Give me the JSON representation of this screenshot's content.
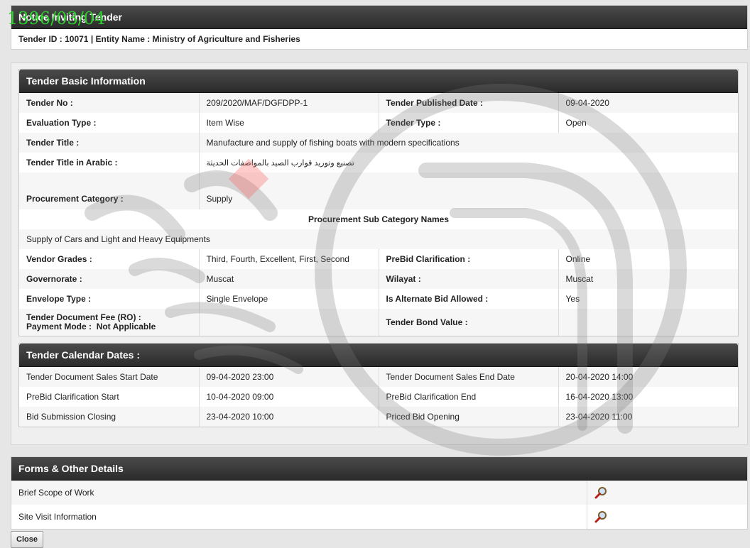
{
  "stamp": "1396/03/04",
  "notice": {
    "title": "Notice Inviting Tender",
    "id_line": "Tender ID : 10071 | Entity Name : Ministry of Agriculture and Fisheries"
  },
  "basic": {
    "title": "Tender Basic Information",
    "tender_no_label": "Tender No :",
    "tender_no": "209/2020/MAF/DGFDPP-1",
    "published_label": "Tender Published Date :",
    "published": "09-04-2020",
    "eval_label": "Evaluation Type :",
    "eval": "Item Wise",
    "type_label": "Tender Type :",
    "type": "Open",
    "title_label": "Tender Title :",
    "tender_title": "Manufacture and supply of fishing boats with modern specifications",
    "arabic_label": "Tender Title in Arabic :",
    "arabic_title": "تصنيع وتوريد قوارب الصيد بالمواصفات الحديثة",
    "category_label": "Procurement Category :",
    "category": "Supply",
    "subcat_header": "Procurement Sub Category Names",
    "subcat": "Supply of Cars and Light and Heavy Equipments",
    "grades_label": "Vendor Grades :",
    "grades": "Third, Fourth, Excellent, First, Second",
    "prebid_label": "PreBid Clarification :",
    "prebid": "Online",
    "gov_label": "Governorate :",
    "gov": "Muscat",
    "wilayat_label": "Wilayat :",
    "wilayat": "Muscat",
    "envelope_label": "Envelope Type :",
    "envelope": "Single Envelope",
    "alt_label": "Is Alternate Bid Allowed :",
    "alt": "Yes",
    "fee_label": "Tender Document Fee (RO) :",
    "payment_label": "Payment Mode :",
    "payment": "Not Applicable",
    "bond_label": "Tender Bond Value :",
    "bond": ""
  },
  "calendar": {
    "title": "Tender Calendar Dates :",
    "rows": [
      {
        "l1": "Tender Document Sales Start Date",
        "v1": "09-04-2020 23:00",
        "l2": "Tender Document Sales End Date",
        "v2": "20-04-2020 14:00"
      },
      {
        "l1": "PreBid Clarification Start",
        "v1": "10-04-2020 09:00",
        "l2": "PreBid Clarification End",
        "v2": "16-04-2020 13:00"
      },
      {
        "l1": "Bid Submission Closing",
        "v1": "23-04-2020 10:00",
        "l2": "Priced Bid Opening",
        "v2": "23-04-2020 11:00"
      }
    ]
  },
  "forms": {
    "title": "Forms & Other Details",
    "items": [
      {
        "label": "Brief Scope of Work",
        "icon": "magnifier-icon"
      },
      {
        "label": "Site Visit Information",
        "icon": "magnifier-icon"
      }
    ]
  },
  "close_label": "Close",
  "colors": {
    "header_dark": "#333333",
    "stamp_green": "#2bd12b",
    "page_bg": "#e6e6e6"
  }
}
